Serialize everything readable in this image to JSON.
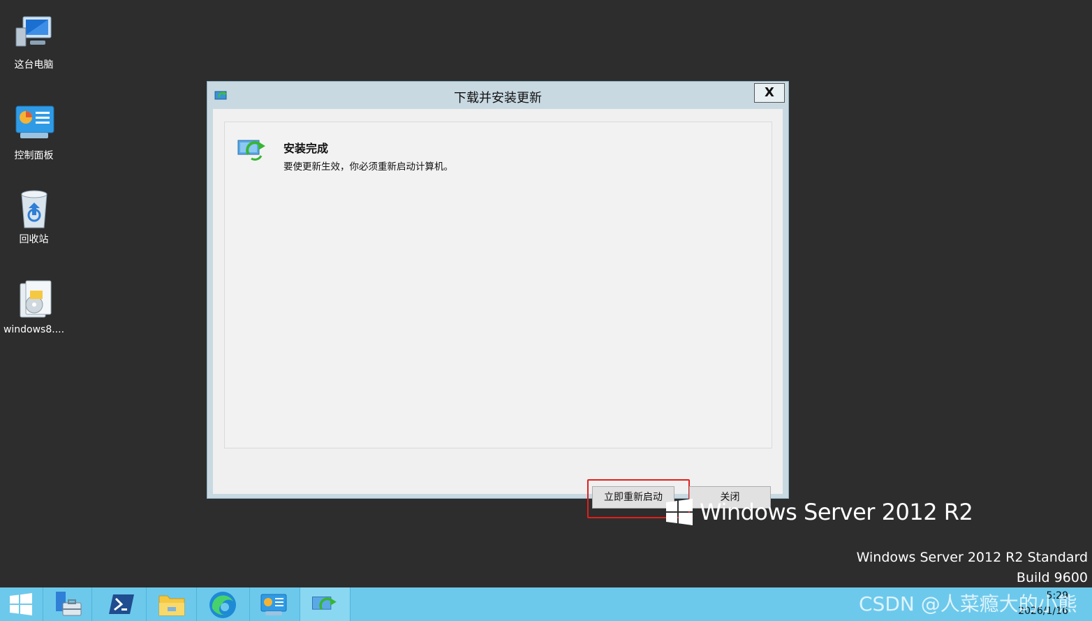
{
  "desktop": {
    "icons": [
      {
        "label": "这台电脑"
      },
      {
        "label": "控制面板"
      },
      {
        "label": "回收站"
      },
      {
        "label": "windows8...."
      }
    ]
  },
  "dialog": {
    "title": "下载并安装更新",
    "close_glyph": "X",
    "heading": "安装完成",
    "message": "要使更新生效，你必须重新启动计算机。",
    "restart_label": "立即重新启动",
    "close_label": "关闭"
  },
  "branding": {
    "product": "Windows Server 2012 R2",
    "edition": "Windows Server 2012 R2 Standard",
    "build": "Build 9600"
  },
  "taskbar": {
    "watermark": "CSDN @人菜瘾大的小熊",
    "time": "5:29",
    "date": "2026/1/16"
  },
  "colors": {
    "desktop": "#2d2d2d",
    "taskbar": "#6cc9ec",
    "highlight": "#e0201b"
  }
}
